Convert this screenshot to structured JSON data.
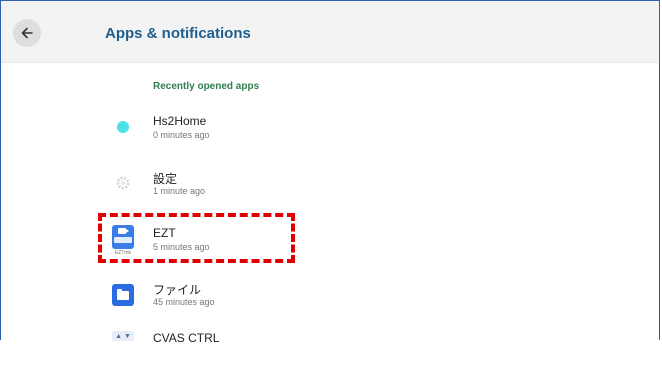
{
  "header": {
    "title": "Apps & notifications"
  },
  "section": {
    "title": "Recently opened apps"
  },
  "apps": [
    {
      "name": "Hs2Home",
      "time": "0 minutes ago",
      "icon": "dot-icon"
    },
    {
      "name": "設定",
      "time": "1 minute ago",
      "icon": "settings-gear-icon"
    },
    {
      "name": "EZT",
      "time": "5 minutes ago",
      "icon": "ezt-app-icon",
      "icon_sub": "EZTmk"
    },
    {
      "name": "ファイル",
      "time": "45 minutes ago",
      "icon": "folder-icon"
    },
    {
      "name": "CVAS CTRL",
      "icon": "cvas-ctrl-icon",
      "icon_text": "▲ ▼"
    }
  ],
  "colors": {
    "title": "#1e5f8f",
    "section": "#2f7f4f",
    "highlight": "#e00000",
    "ezt_icon": "#3b7de6",
    "folder_icon": "#2c6be0",
    "dot": "#4fe0e4"
  }
}
